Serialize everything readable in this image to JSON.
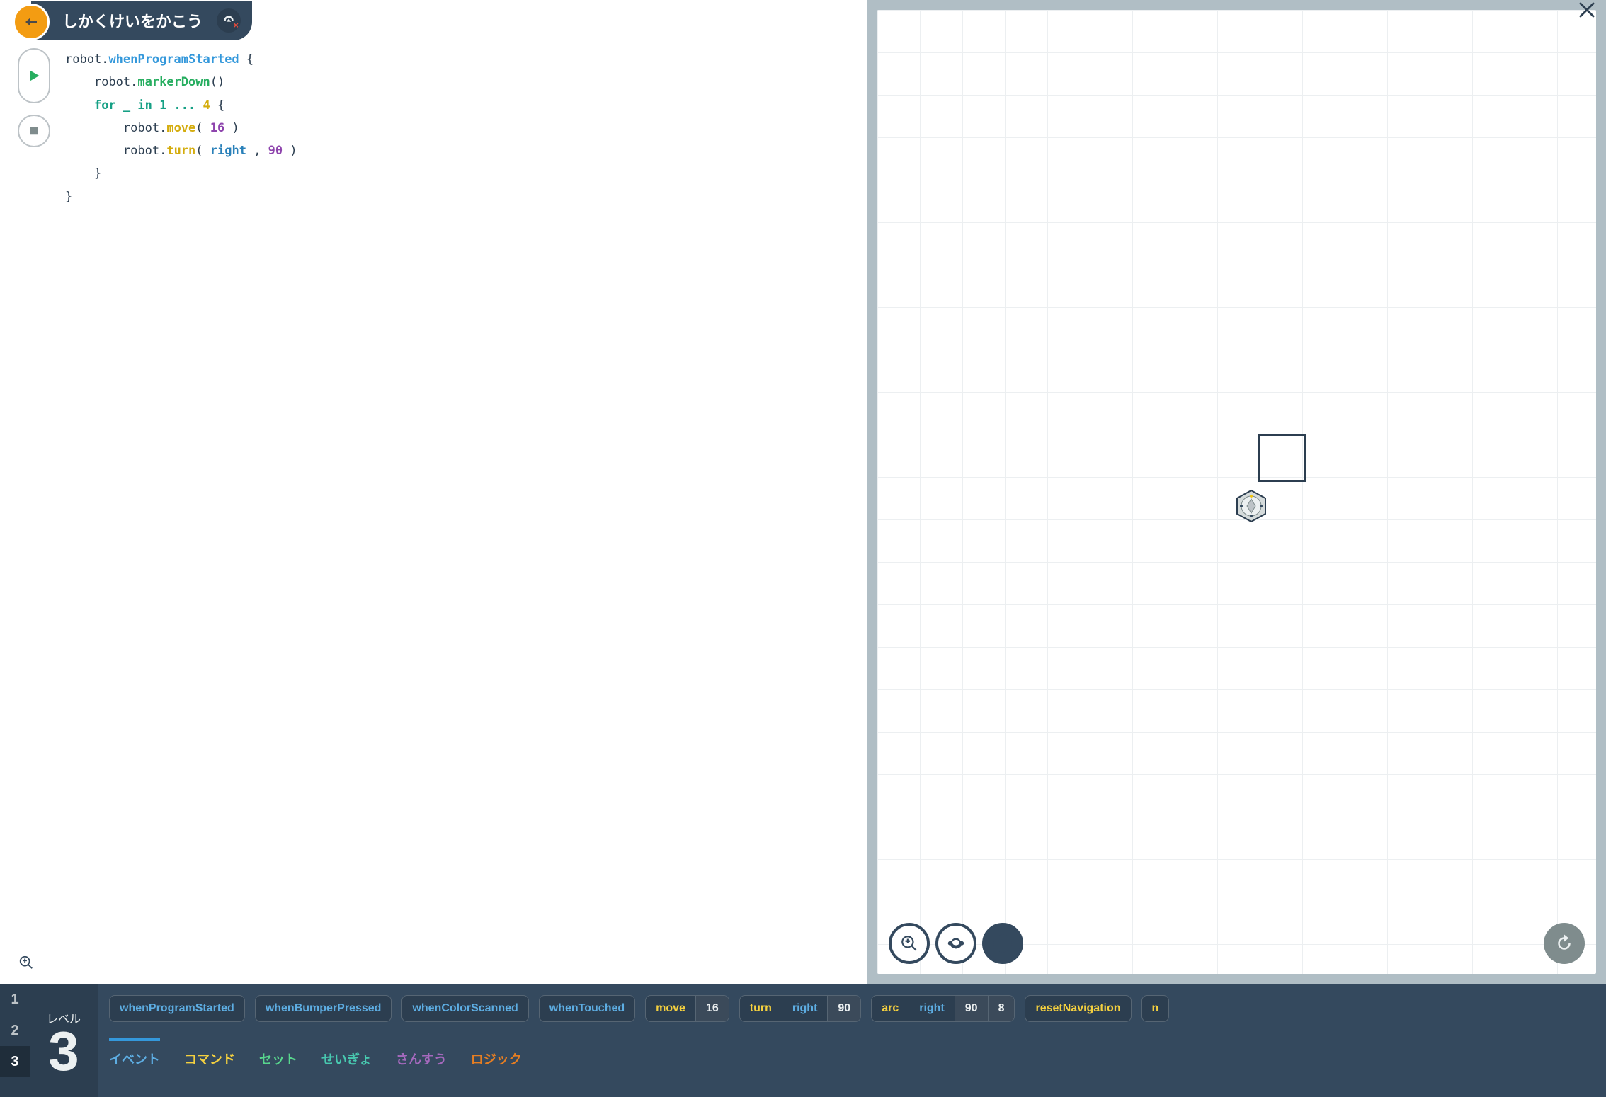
{
  "header": {
    "title": "しかくけいをかこう"
  },
  "code": {
    "prefix": "robot",
    "event": "whenProgramStarted",
    "markerDown": "markerDown",
    "for_kw": "for",
    "for_rest": " _ in 1 ... ",
    "for_count": "4",
    "move": "move",
    "move_val": "16",
    "turn": "turn",
    "turn_dir": "right",
    "turn_val": "90"
  },
  "stage": {
    "btn_zoom": "zoom",
    "btn_speed": "speed",
    "btn_pen": "pen",
    "btn_reset": "reset"
  },
  "level": {
    "label": "レベル",
    "value": "3",
    "tabs": [
      "1",
      "2",
      "3"
    ],
    "active": "3"
  },
  "palette": {
    "blocks": [
      {
        "type": "event",
        "segs": [
          {
            "t": "whenProgramStarted"
          }
        ]
      },
      {
        "type": "event",
        "segs": [
          {
            "t": "whenBumperPressed"
          }
        ]
      },
      {
        "type": "event",
        "segs": [
          {
            "t": "whenColorScanned"
          }
        ]
      },
      {
        "type": "event",
        "segs": [
          {
            "t": "whenTouched"
          }
        ]
      },
      {
        "type": "cmd",
        "segs": [
          {
            "t": "move",
            "c": "kw"
          },
          {
            "t": "16",
            "c": "num"
          }
        ]
      },
      {
        "type": "cmd",
        "segs": [
          {
            "t": "turn",
            "c": "kw"
          },
          {
            "t": "right",
            "c": "dir"
          },
          {
            "t": "90",
            "c": "num"
          }
        ]
      },
      {
        "type": "cmd",
        "segs": [
          {
            "t": "arc",
            "c": "kw"
          },
          {
            "t": "right",
            "c": "dir"
          },
          {
            "t": "90",
            "c": "num"
          },
          {
            "t": "8",
            "c": "num"
          }
        ]
      },
      {
        "type": "cmd",
        "segs": [
          {
            "t": "resetNavigation",
            "c": "kw"
          }
        ]
      },
      {
        "type": "cmd",
        "segs": [
          {
            "t": "n",
            "c": "kw"
          }
        ]
      }
    ],
    "categories": [
      {
        "label": "イベント",
        "color": "#5dade2",
        "active": true
      },
      {
        "label": "コマンド",
        "color": "#f4d03f"
      },
      {
        "label": "セット",
        "color": "#58d68d"
      },
      {
        "label": "せいぎょ",
        "color": "#48c9b0"
      },
      {
        "label": "さんすう",
        "color": "#a569bd"
      },
      {
        "label": "ロジック",
        "color": "#e67e22"
      }
    ]
  }
}
